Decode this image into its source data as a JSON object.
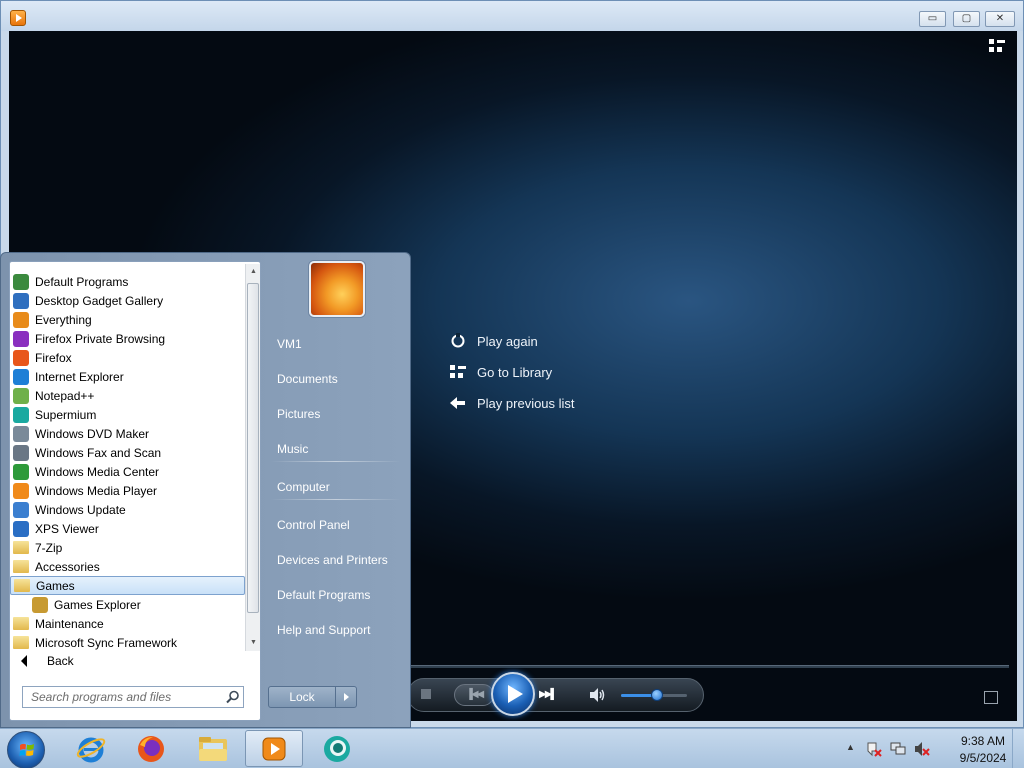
{
  "window": {
    "title": "",
    "controls": {
      "minimize": "▭",
      "maximize": "▢",
      "close": "✕"
    }
  },
  "player": {
    "actions": [
      {
        "label": "Play again",
        "icon": "replay-icon"
      },
      {
        "label": "Go to Library",
        "icon": "library-icon"
      },
      {
        "label": "Play previous list",
        "icon": "back-arrow-icon"
      }
    ],
    "volume_level": 0.55,
    "accent_color": "#1a5fb4"
  },
  "start_menu": {
    "programs": [
      {
        "label": "Default Programs",
        "icon": "default-programs-icon",
        "color": "#3b8a3e"
      },
      {
        "label": "Desktop Gadget Gallery",
        "icon": "gadget-gallery-icon",
        "color": "#2f6fbf"
      },
      {
        "label": "Everything",
        "icon": "everything-search-icon",
        "color": "#e88b1a"
      },
      {
        "label": "Firefox Private Browsing",
        "icon": "firefox-private-icon",
        "color": "#8a2fbf"
      },
      {
        "label": "Firefox",
        "icon": "firefox-icon",
        "color": "#e8561a"
      },
      {
        "label": "Internet Explorer",
        "icon": "internet-explorer-icon",
        "color": "#1e7fd6"
      },
      {
        "label": "Notepad++",
        "icon": "notepadpp-icon",
        "color": "#6fb04a"
      },
      {
        "label": "Supermium",
        "icon": "supermium-icon",
        "color": "#1aa9a0"
      },
      {
        "label": "Windows DVD Maker",
        "icon": "dvd-maker-icon",
        "color": "#7a8a99"
      },
      {
        "label": "Windows Fax and Scan",
        "icon": "fax-scan-icon",
        "color": "#6a7785"
      },
      {
        "label": "Windows Media Center",
        "icon": "media-center-icon",
        "color": "#2e9a3a"
      },
      {
        "label": "Windows Media Player",
        "icon": "media-player-icon",
        "color": "#f08a1a"
      },
      {
        "label": "Windows Update",
        "icon": "windows-update-icon",
        "color": "#3b7fd0"
      },
      {
        "label": "XPS Viewer",
        "icon": "xps-viewer-icon",
        "color": "#2a6ec4"
      },
      {
        "label": "7-Zip",
        "icon": "folder-icon",
        "color": "#e2b84c",
        "folder": true
      },
      {
        "label": "Accessories",
        "icon": "folder-icon",
        "color": "#e2b84c",
        "folder": true
      },
      {
        "label": "Games",
        "icon": "folder-icon",
        "color": "#e2b84c",
        "folder": true,
        "selected": true
      },
      {
        "label": "Games Explorer",
        "icon": "games-explorer-icon",
        "color": "#c79a32",
        "sub": true
      },
      {
        "label": "Maintenance",
        "icon": "folder-icon",
        "color": "#e2b84c",
        "folder": true
      },
      {
        "label": "Microsoft Sync Framework",
        "icon": "folder-icon",
        "color": "#e2b84c",
        "folder": true
      }
    ],
    "back_label": "Back",
    "search_placeholder": "Search programs and files",
    "right_items": [
      {
        "label": "VM1",
        "name": "user-folder-link"
      },
      {
        "label": "Documents",
        "name": "documents-link"
      },
      {
        "label": "Pictures",
        "name": "pictures-link"
      },
      {
        "label": "Music",
        "name": "music-link"
      },
      {
        "label": "Computer",
        "name": "computer-link"
      },
      {
        "label": "Control Panel",
        "name": "control-panel-link"
      },
      {
        "label": "Devices and Printers",
        "name": "devices-printers-link"
      },
      {
        "label": "Default Programs",
        "name": "default-programs-link"
      },
      {
        "label": "Help and Support",
        "name": "help-support-link"
      }
    ],
    "lock_label": "Lock"
  },
  "taskbar": {
    "pinned": [
      "internet-explorer-icon",
      "firefox-icon",
      "file-explorer-icon",
      "media-player-icon",
      "supermium-icon"
    ],
    "tray_expand": "▲",
    "clock_time": "9:38 AM",
    "clock_date": "9/5/2024"
  }
}
